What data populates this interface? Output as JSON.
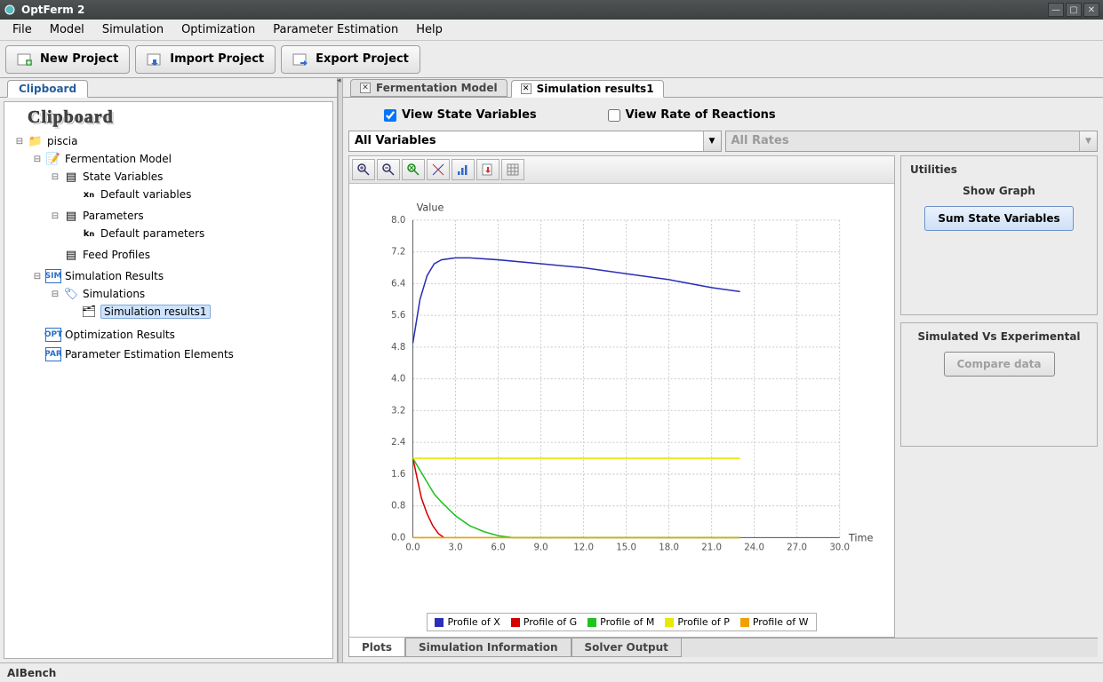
{
  "window": {
    "title": "OptFerm 2"
  },
  "menu": [
    "File",
    "Model",
    "Simulation",
    "Optimization",
    "Parameter Estimation",
    "Help"
  ],
  "toolbar": {
    "new_project": "New Project",
    "import_project": "Import Project",
    "export_project": "Export Project"
  },
  "sidebar": {
    "tab": "Clipboard",
    "heading": "Clipboard",
    "project": "piscia",
    "nodes": {
      "fermentation_model": "Fermentation Model",
      "state_variables": "State Variables",
      "default_variables": "Default variables",
      "parameters": "Parameters",
      "default_parameters": "Default parameters",
      "feed_profiles": "Feed Profiles",
      "simulation_results": "Simulation Results",
      "simulations": "Simulations",
      "simulation_results1": "Simulation results1",
      "optimization_results": "Optimization Results",
      "parameter_estimation_elements": "Parameter Estimation Elements"
    }
  },
  "doc_tabs": {
    "fermentation_model": "Fermentation Model",
    "simulation_results1": "Simulation results1"
  },
  "view_options": {
    "view_state_variables": "View State Variables",
    "view_rate_reactions": "View Rate of Reactions"
  },
  "combos": {
    "variables": "All Variables",
    "rates": "All Rates"
  },
  "chart_toolbar_icons": [
    "zoom-in-icon",
    "zoom-out-icon",
    "reset-zoom-icon",
    "crosshair-icon",
    "series-icon",
    "export-icon",
    "grid-icon"
  ],
  "utilities": {
    "heading": "Utilities",
    "show_graph": "Show Graph",
    "sum_state_variables": "Sum State Variables",
    "sve_heading": "Simulated Vs Experimental",
    "compare_data": "Compare data"
  },
  "bottom_tabs": [
    "Plots",
    "Simulation Information",
    "Solver Output"
  ],
  "statusbar": "AIBench",
  "chart_data": {
    "type": "line",
    "title": "",
    "xlabel": "Time",
    "ylabel": "Value",
    "xlim": [
      0,
      30
    ],
    "ylim": [
      0,
      8
    ],
    "xticks": [
      0.0,
      3.0,
      6.0,
      9.0,
      12.0,
      15.0,
      18.0,
      21.0,
      24.0,
      27.0,
      30.0
    ],
    "yticks": [
      0.0,
      0.8,
      1.6,
      2.4,
      3.2,
      4.0,
      4.8,
      5.6,
      6.4,
      7.2,
      8.0
    ],
    "series": [
      {
        "name": "Profile of X",
        "color": "#2a2fb5",
        "x": [
          0,
          0.5,
          1,
          1.5,
          2,
          3,
          4,
          6,
          9,
          12,
          15,
          18,
          21,
          23
        ],
        "y": [
          4.9,
          6.0,
          6.6,
          6.9,
          7.0,
          7.05,
          7.05,
          7.0,
          6.9,
          6.8,
          6.65,
          6.5,
          6.3,
          6.2
        ]
      },
      {
        "name": "Profile of G",
        "color": "#d40000",
        "x": [
          0,
          0.3,
          0.6,
          1.0,
          1.4,
          1.8,
          2.2
        ],
        "y": [
          2.0,
          1.5,
          1.0,
          0.6,
          0.3,
          0.1,
          0.0
        ]
      },
      {
        "name": "Profile of M",
        "color": "#1fc21f",
        "x": [
          0,
          0.5,
          1,
          1.5,
          2,
          3,
          4,
          5,
          6,
          7,
          23
        ],
        "y": [
          2.0,
          1.7,
          1.4,
          1.1,
          0.9,
          0.55,
          0.3,
          0.15,
          0.05,
          0.0,
          0.0
        ]
      },
      {
        "name": "Profile of P",
        "color": "#e8e800",
        "x": [
          0,
          23
        ],
        "y": [
          2.0,
          2.0
        ]
      },
      {
        "name": "Profile of W",
        "color": "#f0a000",
        "x": [
          0,
          23
        ],
        "y": [
          0.0,
          0.0
        ]
      }
    ]
  }
}
